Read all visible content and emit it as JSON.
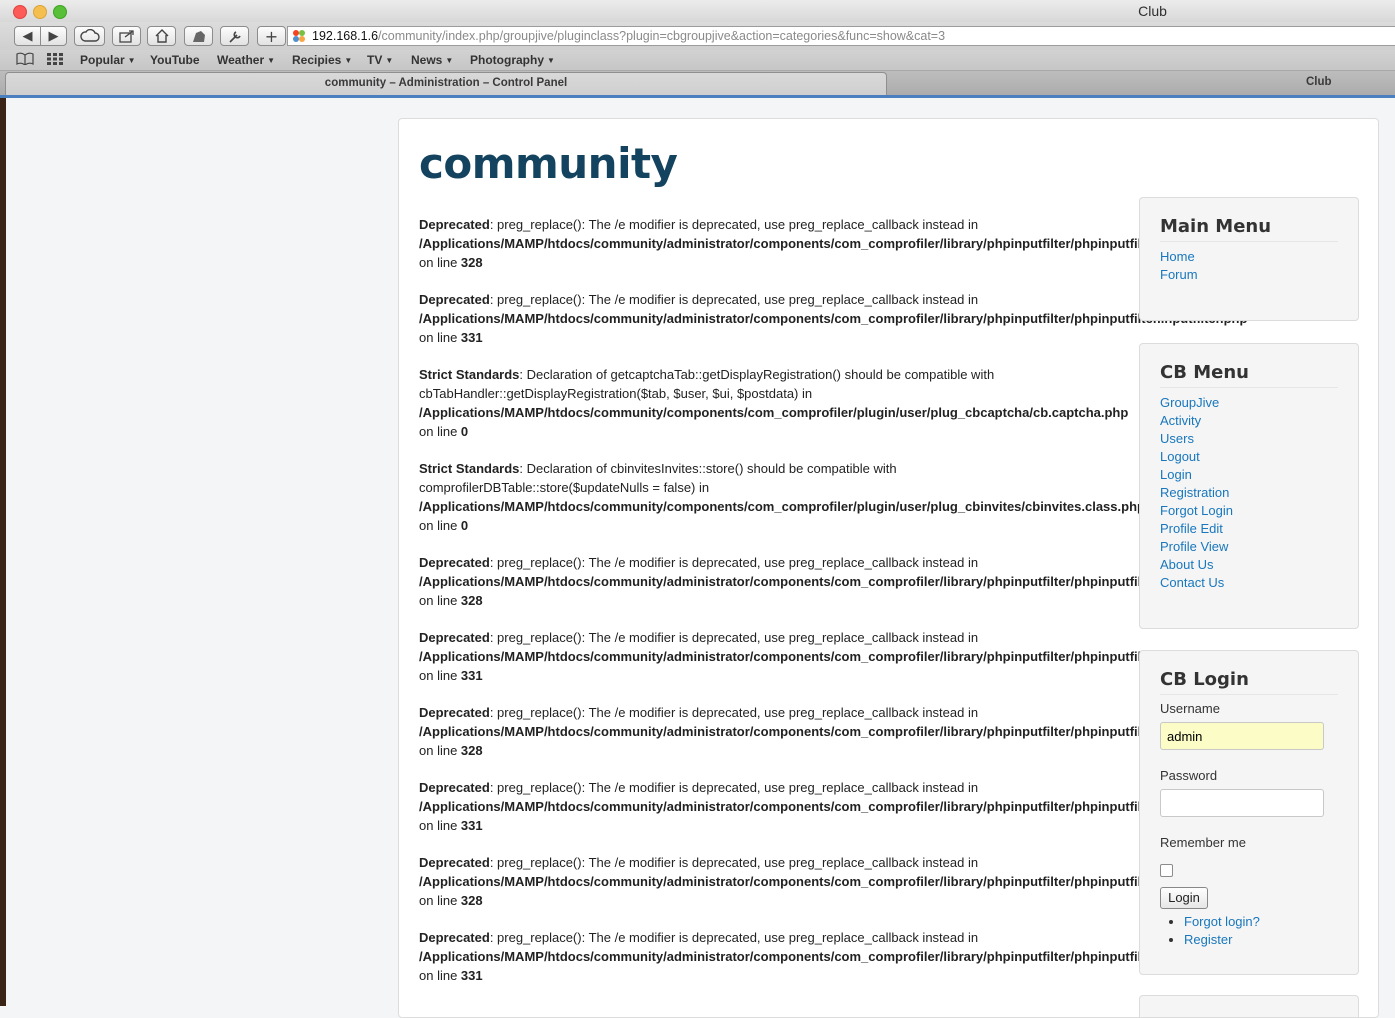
{
  "window": {
    "title": "Club"
  },
  "toolbar": {
    "url_host": "192.168.1.6",
    "url_path": "/community/index.php/groupjive/pluginclass?plugin=cbgroupjive&action=categories&func=show&cat=3"
  },
  "bookmarks": [
    "Popular",
    "YouTube",
    "Weather",
    "Recipies",
    "TV",
    "News",
    "Photography"
  ],
  "tabs": {
    "active": "community – Administration – Control Panel",
    "other": "Club"
  },
  "site": {
    "title": "community"
  },
  "messages": [
    {
      "type": "Deprecated",
      "text": ": preg_replace(): The /e modifier is deprecated, use preg_replace_callback instead in",
      "extra": "",
      "path": "/Applications/MAMP/htdocs/community/administrator/components/com_comprofiler/library/phpinputfilter/phpinputfilter.inputfilter.php",
      "line_label": "on line ",
      "line": "328"
    },
    {
      "type": "Deprecated",
      "text": ": preg_replace(): The /e modifier is deprecated, use preg_replace_callback instead in",
      "extra": "",
      "path": "/Applications/MAMP/htdocs/community/administrator/components/com_comprofiler/library/phpinputfilter/phpinputfilter.inputfilter.php",
      "line_label": "on line ",
      "line": "331"
    },
    {
      "type": "Strict Standards",
      "text": ": Declaration of getcaptchaTab::getDisplayRegistration() should be compatible with",
      "extra": "cbTabHandler::getDisplayRegistration($tab, $user, $ui, $postdata) in",
      "path": "/Applications/MAMP/htdocs/community/components/com_comprofiler/plugin/user/plug_cbcaptcha/cb.captcha.php",
      "line_label": "on line ",
      "line": "0"
    },
    {
      "type": "Strict Standards",
      "text": ": Declaration of cbinvitesInvites::store() should be compatible with",
      "extra": "comprofilerDBTable::store($updateNulls = false) in",
      "path": "/Applications/MAMP/htdocs/community/components/com_comprofiler/plugin/user/plug_cbinvites/cbinvites.class.php",
      "line_label": "on line ",
      "line": "0"
    },
    {
      "type": "Deprecated",
      "text": ": preg_replace(): The /e modifier is deprecated, use preg_replace_callback instead in",
      "extra": "",
      "path": "/Applications/MAMP/htdocs/community/administrator/components/com_comprofiler/library/phpinputfilter/phpinputfilter.inputfilter.php",
      "line_label": "on line ",
      "line": "328"
    },
    {
      "type": "Deprecated",
      "text": ": preg_replace(): The /e modifier is deprecated, use preg_replace_callback instead in",
      "extra": "",
      "path": "/Applications/MAMP/htdocs/community/administrator/components/com_comprofiler/library/phpinputfilter/phpinputfilter.inputfilter.php",
      "line_label": "on line ",
      "line": "331"
    },
    {
      "type": "Deprecated",
      "text": ": preg_replace(): The /e modifier is deprecated, use preg_replace_callback instead in",
      "extra": "",
      "path": "/Applications/MAMP/htdocs/community/administrator/components/com_comprofiler/library/phpinputfilter/phpinputfilter.inputfilter.php",
      "line_label": "on line ",
      "line": "328"
    },
    {
      "type": "Deprecated",
      "text": ": preg_replace(): The /e modifier is deprecated, use preg_replace_callback instead in",
      "extra": "",
      "path": "/Applications/MAMP/htdocs/community/administrator/components/com_comprofiler/library/phpinputfilter/phpinputfilter.inputfilter.php",
      "line_label": "on line ",
      "line": "331"
    },
    {
      "type": "Deprecated",
      "text": ": preg_replace(): The /e modifier is deprecated, use preg_replace_callback instead in",
      "extra": "",
      "path": "/Applications/MAMP/htdocs/community/administrator/components/com_comprofiler/library/phpinputfilter/phpinputfilter.inputfilter.php",
      "line_label": "on line ",
      "line": "328"
    },
    {
      "type": "Deprecated",
      "text": ": preg_replace(): The /e modifier is deprecated, use preg_replace_callback instead in",
      "extra": "",
      "path": "/Applications/MAMP/htdocs/community/administrator/components/com_comprofiler/library/phpinputfilter/phpinputfilter.inputfilter.php",
      "line_label": "on line ",
      "line": "331"
    }
  ],
  "main_menu": {
    "title": "Main Menu",
    "items": [
      "Home",
      "Forum"
    ]
  },
  "cb_menu": {
    "title": "CB Menu",
    "items": [
      "GroupJive",
      "Activity",
      "Users",
      "Logout",
      "Login",
      "Registration",
      "Forgot Login",
      "Profile Edit",
      "Profile View",
      "About Us",
      "Contact Us"
    ]
  },
  "cb_login": {
    "title": "CB Login",
    "username_label": "Username",
    "username_value": "admin",
    "password_label": "Password",
    "remember_label": "Remember me",
    "login_button": "Login",
    "links": [
      "Forgot login?",
      "Register"
    ]
  },
  "colors": {
    "link": "#1877bd",
    "title": "#13435f",
    "tab_accent": "#4a7fbf"
  }
}
